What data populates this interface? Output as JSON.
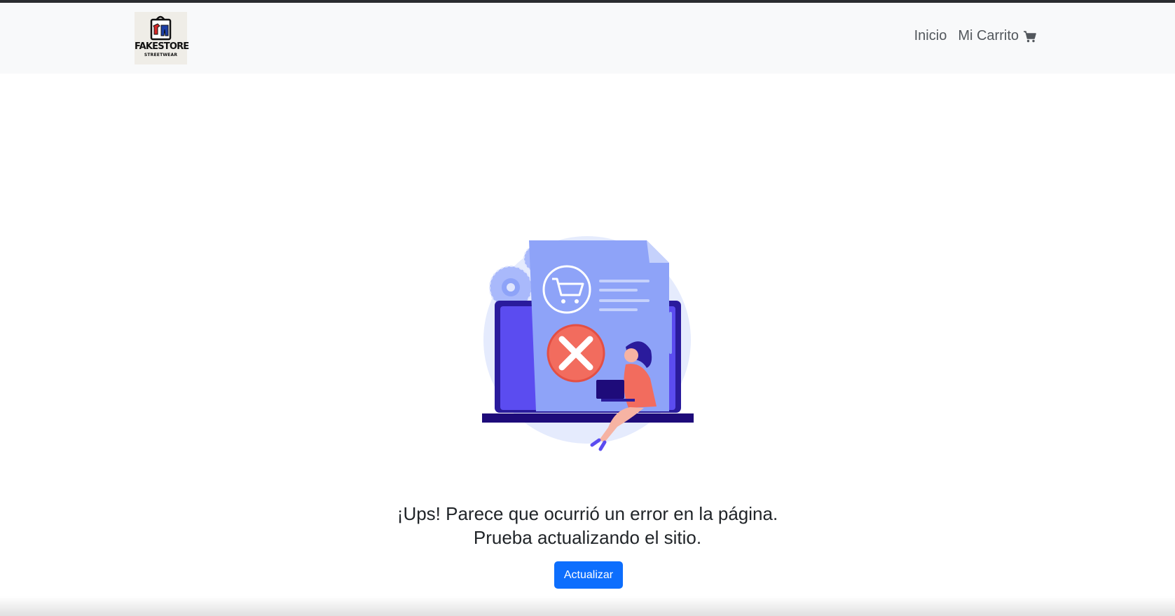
{
  "navbar": {
    "logo": {
      "brand": "FAKESTORE",
      "tagline": "STREETWEAR"
    },
    "links": [
      {
        "label": "Inicio",
        "icon": ""
      },
      {
        "label": "Mi Carrito",
        "icon": "cart-icon"
      }
    ]
  },
  "illustration": {
    "subject": "error-cart-illustration",
    "accent_colors": [
      "#5b5bf5",
      "#8ea3f8",
      "#e5ebfd",
      "#f26c5e",
      "#1e0b7a"
    ]
  },
  "error": {
    "line1": "¡Ups! Parece que ocurrió un error en la página.",
    "line2": "Prueba actualizando el sitio."
  },
  "actions": {
    "refresh_label": "Actualizar"
  },
  "colors": {
    "primary": "#0d6efd",
    "navbar_bg": "#f8f9fa",
    "text": "#212529",
    "nav_text": "#52575c"
  }
}
